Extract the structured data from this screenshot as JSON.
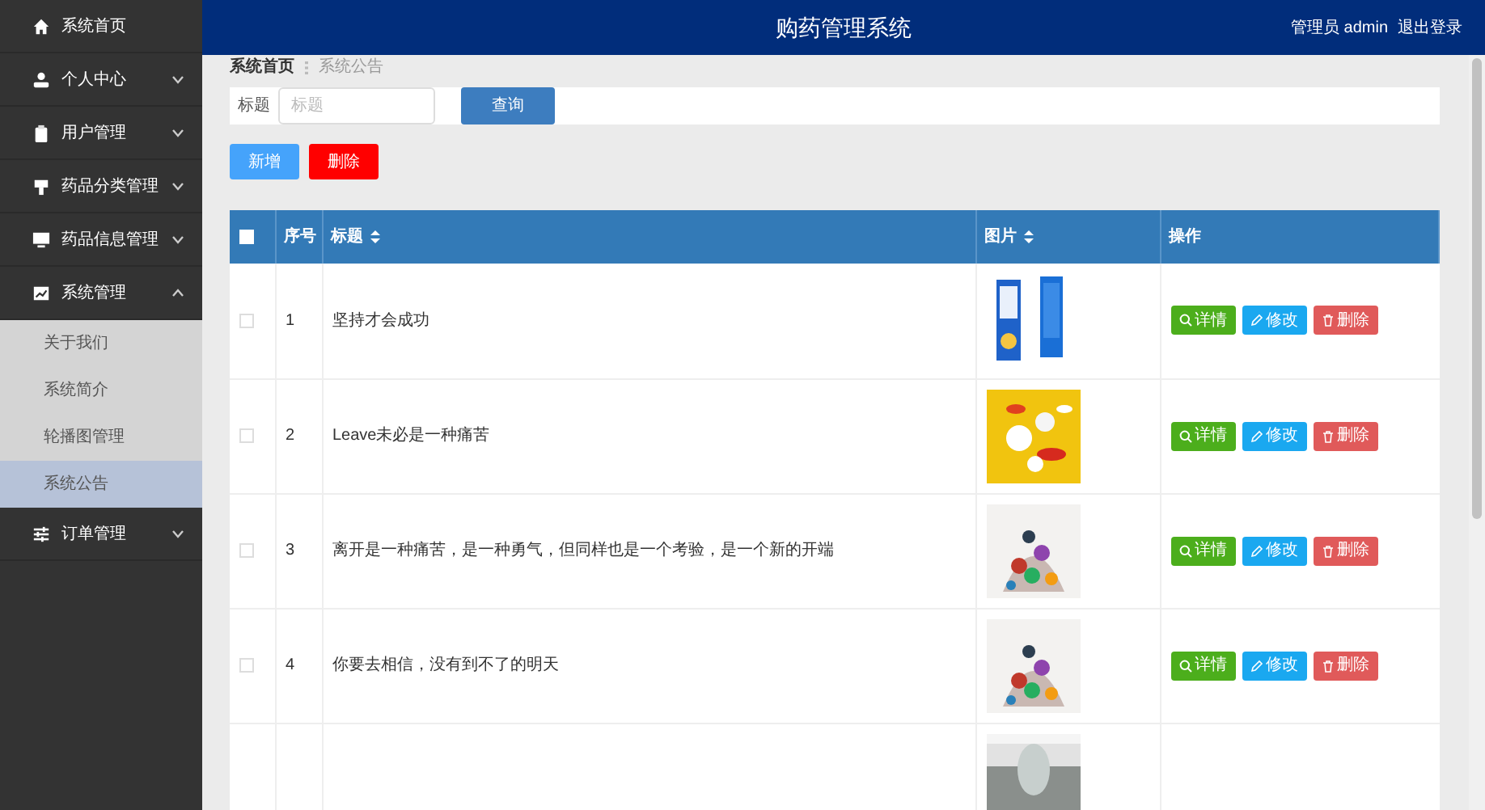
{
  "header": {
    "title": "购药管理系统",
    "user": "管理员 admin",
    "logout": "退出登录"
  },
  "sidebar": {
    "items": [
      {
        "kind": "link",
        "label": "系统首页"
      },
      {
        "kind": "menu",
        "label": "个人中心",
        "expanded": false
      },
      {
        "kind": "menu",
        "label": "用户管理",
        "expanded": false
      },
      {
        "kind": "menu",
        "label": "药品分类管理",
        "expanded": false
      },
      {
        "kind": "menu",
        "label": "药品信息管理",
        "expanded": false
      },
      {
        "kind": "menu",
        "label": "系统管理",
        "expanded": true,
        "children": [
          {
            "label": "关于我们",
            "selected": false
          },
          {
            "label": "系统简介",
            "selected": false
          },
          {
            "label": "轮播图管理",
            "selected": false
          },
          {
            "label": "系统公告",
            "selected": true
          }
        ]
      },
      {
        "kind": "menu",
        "label": "订单管理",
        "expanded": false
      }
    ]
  },
  "breadcrumb": [
    "系统首页",
    "系统公告"
  ],
  "search": {
    "label": "标题",
    "placeholder": "标题",
    "button": "查询"
  },
  "actions": [
    "新增",
    "删除"
  ],
  "table": {
    "select_all_checked": false,
    "columns": [
      {
        "label": "序号",
        "sortable": false
      },
      {
        "label": "标题",
        "sortable": true
      },
      {
        "label": "图片",
        "sortable": true
      },
      {
        "label": "操作",
        "sortable": false
      }
    ],
    "rows": [
      {
        "checked": false,
        "index": "1",
        "title": "坚持才会成功",
        "buttons": [
          "详情",
          "修改",
          "删除"
        ]
      },
      {
        "checked": false,
        "index": "2",
        "title": "Leave未必是一种痛苦",
        "buttons": [
          "详情",
          "修改",
          "删除"
        ]
      },
      {
        "checked": false,
        "index": "3",
        "title": "离开是一种痛苦，是一种勇气，但同样也是一个考验，是一个新的开端",
        "buttons": [
          "详情",
          "修改",
          "删除"
        ]
      },
      {
        "checked": false,
        "index": "4",
        "title": "你要去相信，没有到不了的明天",
        "buttons": [
          "详情",
          "修改",
          "删除"
        ]
      },
      {
        "kind": "partial"
      }
    ]
  }
}
